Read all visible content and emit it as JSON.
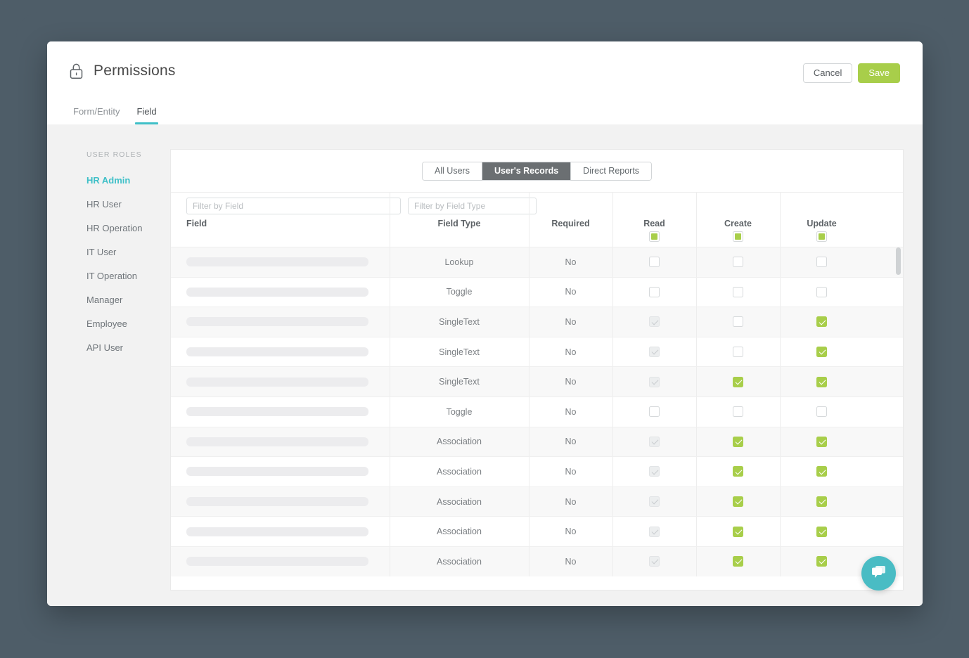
{
  "header": {
    "title": "Permissions",
    "lock_icon": "lock-icon",
    "cancel_label": "Cancel",
    "save_label": "Save",
    "accent_green": "#a8ce4a",
    "accent_teal": "#3fc0c8"
  },
  "tabs": [
    {
      "label": "Form/Entity",
      "active": false
    },
    {
      "label": "Field",
      "active": true
    }
  ],
  "sidebar": {
    "header": "USER ROLES",
    "items": [
      {
        "label": "HR Admin",
        "active": true
      },
      {
        "label": "HR User",
        "active": false
      },
      {
        "label": "HR Operation",
        "active": false
      },
      {
        "label": "IT User",
        "active": false
      },
      {
        "label": "IT Operation",
        "active": false
      },
      {
        "label": "Manager",
        "active": false
      },
      {
        "label": "Employee",
        "active": false
      },
      {
        "label": "API User",
        "active": false
      }
    ]
  },
  "scope_selector": {
    "options": [
      {
        "label": "All Users",
        "active": false
      },
      {
        "label": "User's Records",
        "active": true
      },
      {
        "label": "Direct Reports",
        "active": false
      }
    ]
  },
  "filters": {
    "field_placeholder": "Filter by Field",
    "field_value": "",
    "field_type_placeholder": "Filter by Field Type",
    "field_type_value": ""
  },
  "table": {
    "columns": [
      {
        "key": "field",
        "label": "Field",
        "header_checkbox": null
      },
      {
        "key": "type",
        "label": "Field Type",
        "header_checkbox": null
      },
      {
        "key": "required",
        "label": "Required",
        "header_checkbox": null
      },
      {
        "key": "read",
        "label": "Read",
        "header_checkbox": "indeterminate"
      },
      {
        "key": "create",
        "label": "Create",
        "header_checkbox": "indeterminate"
      },
      {
        "key": "update",
        "label": "Update",
        "header_checkbox": "indeterminate"
      }
    ],
    "rows": [
      {
        "field": "",
        "type": "Lookup",
        "required": "No",
        "read": "empty",
        "create": "empty",
        "update": "empty"
      },
      {
        "field": "",
        "type": "Toggle",
        "required": "No",
        "read": "empty",
        "create": "empty",
        "update": "empty"
      },
      {
        "field": "",
        "type": "SingleText",
        "required": "No",
        "read": "gray-checked",
        "create": "empty",
        "update": "checked"
      },
      {
        "field": "",
        "type": "SingleText",
        "required": "No",
        "read": "gray-checked",
        "create": "empty",
        "update": "checked"
      },
      {
        "field": "",
        "type": "SingleText",
        "required": "No",
        "read": "gray-checked",
        "create": "checked",
        "update": "checked"
      },
      {
        "field": "",
        "type": "Toggle",
        "required": "No",
        "read": "empty",
        "create": "empty",
        "update": "empty"
      },
      {
        "field": "",
        "type": "Association",
        "required": "No",
        "read": "gray-checked",
        "create": "checked",
        "update": "checked"
      },
      {
        "field": "",
        "type": "Association",
        "required": "No",
        "read": "gray-checked",
        "create": "checked",
        "update": "checked"
      },
      {
        "field": "",
        "type": "Association",
        "required": "No",
        "read": "gray-checked",
        "create": "checked",
        "update": "checked"
      },
      {
        "field": "",
        "type": "Association",
        "required": "No",
        "read": "gray-checked",
        "create": "checked",
        "update": "checked"
      },
      {
        "field": "",
        "type": "Association",
        "required": "No",
        "read": "gray-checked",
        "create": "checked",
        "update": "checked"
      }
    ]
  },
  "chat_widget": {
    "icon": "chat-bubble-icon",
    "color": "#49bcc4"
  }
}
